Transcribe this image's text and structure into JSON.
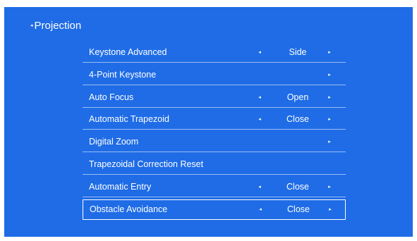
{
  "header": {
    "back_icon": "◂",
    "title": "Projection"
  },
  "menu": {
    "items": [
      {
        "label": "Keystone Advanced",
        "value": "Side",
        "left_arrow": "◂",
        "right_arrow": "▸",
        "selected": false
      },
      {
        "label": "4-Point Keystone",
        "value": "",
        "left_arrow": "",
        "right_arrow": "▸",
        "selected": false
      },
      {
        "label": "Auto Focus",
        "value": "Open",
        "left_arrow": "◂",
        "right_arrow": "▸",
        "selected": false
      },
      {
        "label": "Automatic Trapezoid",
        "value": "Close",
        "left_arrow": "◂",
        "right_arrow": "▸",
        "selected": false
      },
      {
        "label": "Digital Zoom",
        "value": "",
        "left_arrow": "",
        "right_arrow": "▸",
        "selected": false
      },
      {
        "label": "Trapezoidal Correction Reset",
        "value": "",
        "left_arrow": "",
        "right_arrow": "",
        "selected": false
      },
      {
        "label": "Automatic Entry",
        "value": "Close",
        "left_arrow": "◂",
        "right_arrow": "▸",
        "selected": false
      },
      {
        "label": "Obstacle Avoidance",
        "value": "Close",
        "left_arrow": "◂",
        "right_arrow": "▸",
        "selected": true
      }
    ]
  },
  "colors": {
    "background": "#1f6ce6",
    "text": "#ffffff",
    "page": "#ffffff"
  }
}
